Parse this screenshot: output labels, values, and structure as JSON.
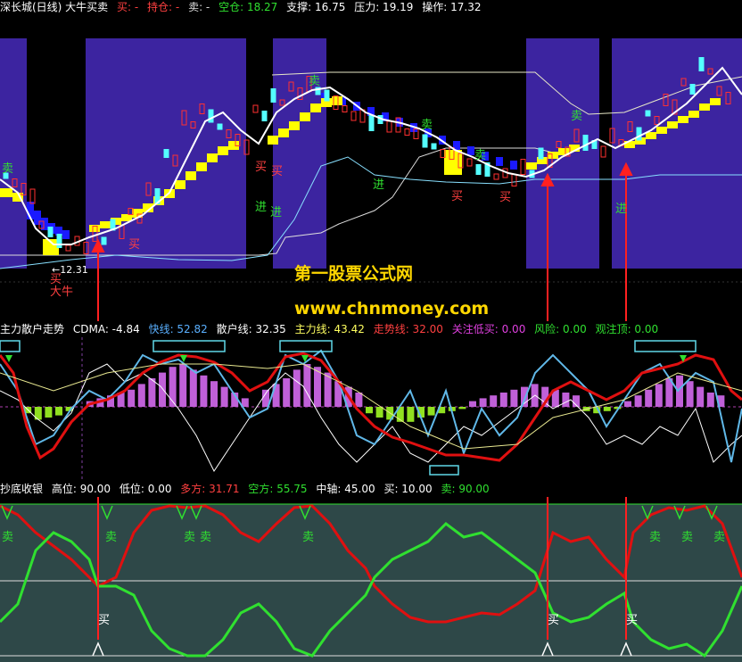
{
  "top_header": {
    "title": "深长城(日线) 大牛买卖",
    "buy": "买: -",
    "hold": "持仓: -",
    "sell": "卖: -",
    "empty": "空仓: 18.27",
    "support": "支撑: 16.75",
    "pressure": "压力: 19.19",
    "operate": "操作: 17.32"
  },
  "price_panel": {
    "low_label": "←12.31",
    "signals": [
      "卖",
      "买",
      "买",
      "买",
      "卖",
      "卖",
      "卖",
      "卖",
      "买",
      "买",
      "进",
      "进",
      "进",
      "进",
      "买",
      "大牛"
    ],
    "watermark": "第一股票公式网",
    "watermark_url": "www.chnmoney.com"
  },
  "mid_header": {
    "title": "主力散户走势",
    "cdma": "CDMA: -4.84",
    "fast": "快线: 52.82",
    "retail": "散户线: 32.35",
    "main": "主力线: 43.42",
    "trend": "走势线: 32.00",
    "watch_low": "关注低买: 0.00",
    "risk": "风险: 0.00",
    "watch_top": "观注顶: 0.00"
  },
  "bottom_header": {
    "title": "抄底收银",
    "high": "高位: 90.00",
    "low": "低位: 0.00",
    "bull": "多方: 31.71",
    "bear": "空方: 55.75",
    "mid": "中轴: 45.00",
    "buy": "买: 10.00",
    "sell": "卖: 90.00"
  },
  "bottom_panel": {
    "sell_label": "卖",
    "buy_label": "买"
  },
  "colors": {
    "up": "#ff3030",
    "down": "#54ffff",
    "purple": "#3c24a0",
    "yellow": "#ffff00",
    "blue": "#1a1aff",
    "green": "#30e030",
    "red": "#e01010"
  }
}
